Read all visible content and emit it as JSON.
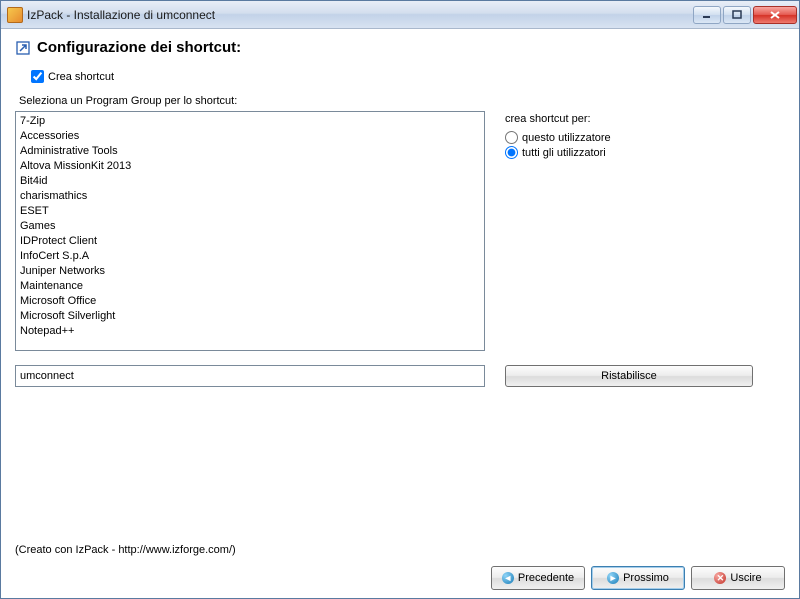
{
  "window": {
    "title": "IzPack - Installazione di umconnect"
  },
  "header": {
    "title": "Configurazione dei shortcut:"
  },
  "create_shortcut": {
    "label": "Crea shortcut",
    "checked": true
  },
  "select_group": {
    "label": "Seleziona un Program Group per lo shortcut:"
  },
  "program_groups": [
    "7-Zip",
    "Accessories",
    "Administrative Tools",
    "Altova MissionKit 2013",
    "Bit4id",
    "charismathics",
    "ESET",
    "Games",
    "IDProtect Client",
    "InfoCert S.p.A",
    "Juniper Networks",
    "Maintenance",
    "Microsoft Office",
    "Microsoft Silverlight",
    "Notepad++"
  ],
  "shortcut_for": {
    "label": "crea shortcut per:",
    "options": {
      "current": "questo utilizzatore",
      "all": "tutti gli utilizzatori"
    },
    "selected": "all"
  },
  "group_input": {
    "value": "umconnect"
  },
  "reset_button": {
    "label": "Ristabilisce"
  },
  "credit": "(Creato con IzPack - http://www.izforge.com/)",
  "nav": {
    "prev": "Precedente",
    "next": "Prossimo",
    "exit": "Uscire"
  }
}
